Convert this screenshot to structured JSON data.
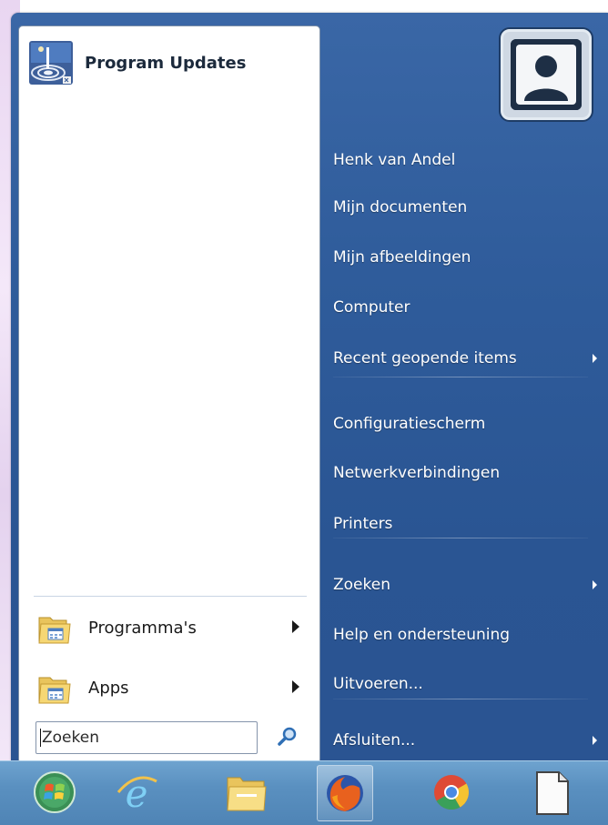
{
  "left_pane": {
    "pinned": {
      "label": "Program Updates",
      "icon": "program-updates-icon"
    },
    "programs": {
      "label": "Programma's",
      "icon": "folder-icon"
    },
    "apps": {
      "label": "Apps",
      "icon": "folder-icon"
    },
    "search": {
      "value": "Zoeken",
      "icon": "search-icon"
    }
  },
  "right_pane": {
    "avatar_icon": "user-avatar-icon",
    "items": [
      {
        "label": "Henk van Andel",
        "submenu": false
      },
      {
        "label": "Mijn documenten",
        "submenu": false
      },
      {
        "label": "Mijn afbeeldingen",
        "submenu": false
      },
      {
        "label": "Computer",
        "submenu": false
      },
      {
        "label": "Recent geopende items",
        "submenu": true
      },
      {
        "label": "Configuratiescherm",
        "submenu": false
      },
      {
        "label": "Netwerkverbindingen",
        "submenu": false
      },
      {
        "label": "Printers",
        "submenu": false
      },
      {
        "label": "Zoeken",
        "submenu": true
      },
      {
        "label": "Help en ondersteuning",
        "submenu": false
      },
      {
        "label": "Uitvoeren...",
        "submenu": false
      },
      {
        "label": "Afsluiten...",
        "submenu": true
      }
    ]
  },
  "taskbar": {
    "items": [
      {
        "name": "start-button",
        "icon": "start-orb-icon"
      },
      {
        "name": "internet-explorer",
        "icon": "internet-explorer-icon"
      },
      {
        "name": "file-explorer",
        "icon": "folder-icon"
      },
      {
        "name": "firefox",
        "icon": "firefox-icon"
      },
      {
        "name": "chrome",
        "icon": "chrome-icon"
      },
      {
        "name": "notepad",
        "icon": "document-icon"
      }
    ]
  },
  "colors": {
    "menu_blue": "#2f5c9b",
    "taskbar_blue": "#5a90c0",
    "left_pane_bg": "#ffffff"
  }
}
